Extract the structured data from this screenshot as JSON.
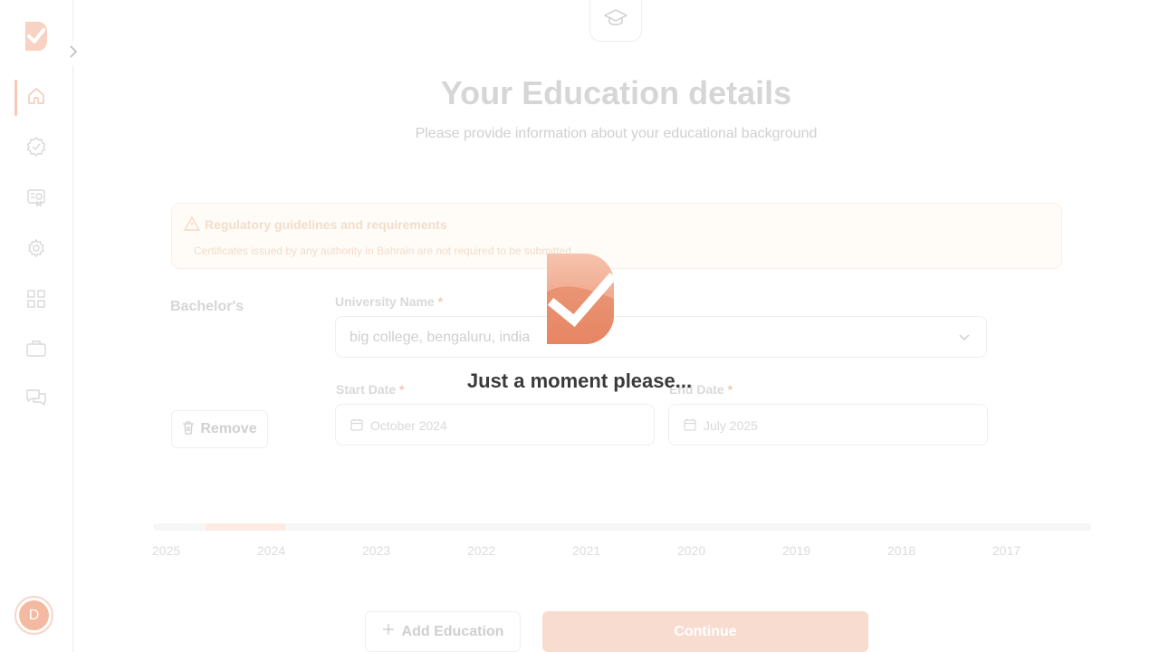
{
  "sidebar": {
    "items": [
      {
        "name": "home",
        "icon": "home-icon",
        "active": true
      },
      {
        "name": "verify",
        "icon": "badge-check-icon"
      },
      {
        "name": "certificate",
        "icon": "certificate-icon"
      },
      {
        "name": "settings",
        "icon": "gear-icon"
      },
      {
        "name": "apps",
        "icon": "grid-icon"
      },
      {
        "name": "jobs",
        "icon": "briefcase-icon"
      },
      {
        "name": "messages",
        "icon": "chat-icon"
      }
    ],
    "avatar_initial": "D"
  },
  "page": {
    "title": "Your Education details",
    "subtitle": "Please provide information about your educational background"
  },
  "notice": {
    "title": "Regulatory guidelines and requirements",
    "text": "Certificates issued by any authority in Bahrain are not required to be submitted."
  },
  "education": {
    "degree": "Bachelor's",
    "university_label": "University Name",
    "university_value": "big college, bengaluru, india",
    "start_label": "Start Date",
    "start_value": "October 2024",
    "end_label": "End Date",
    "end_value": "July 2025",
    "required_mark": "*",
    "remove_label": "Remove"
  },
  "timeline": {
    "years": [
      "2025",
      "2024",
      "2023",
      "2022",
      "2021",
      "2020",
      "2019",
      "2018",
      "2017"
    ]
  },
  "actions": {
    "add_label": "Add Education",
    "continue_label": "Continue"
  },
  "loader": {
    "message": "Just a moment please..."
  },
  "colors": {
    "brand": "#e57a56",
    "brand_light": "#f8dcd0"
  }
}
